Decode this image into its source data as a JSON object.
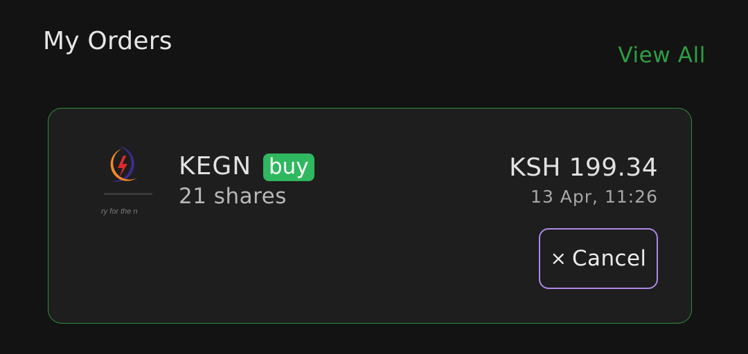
{
  "header": {
    "title": "My Orders",
    "view_all_label": "View All"
  },
  "order": {
    "ticker": "KEGN",
    "side": "buy",
    "shares": "21 shares",
    "amount": "KSH 199.34",
    "timestamp": "13 Apr, 11:26",
    "logo_icon": "kengen-logo",
    "logo_tagline": "ry for the n",
    "cancel_icon": "×",
    "cancel_label": "Cancel"
  },
  "colors": {
    "background": "#131313",
    "card": "#1e1e1e",
    "card_border": "#2f8f3f",
    "accent_green": "#2e9e43",
    "buy_badge": "#2fb85f",
    "cancel_border": "#b088e6",
    "logo_purple": "#3d2c8c",
    "logo_orange": "#f08a2a",
    "logo_red": "#e02a2a"
  }
}
